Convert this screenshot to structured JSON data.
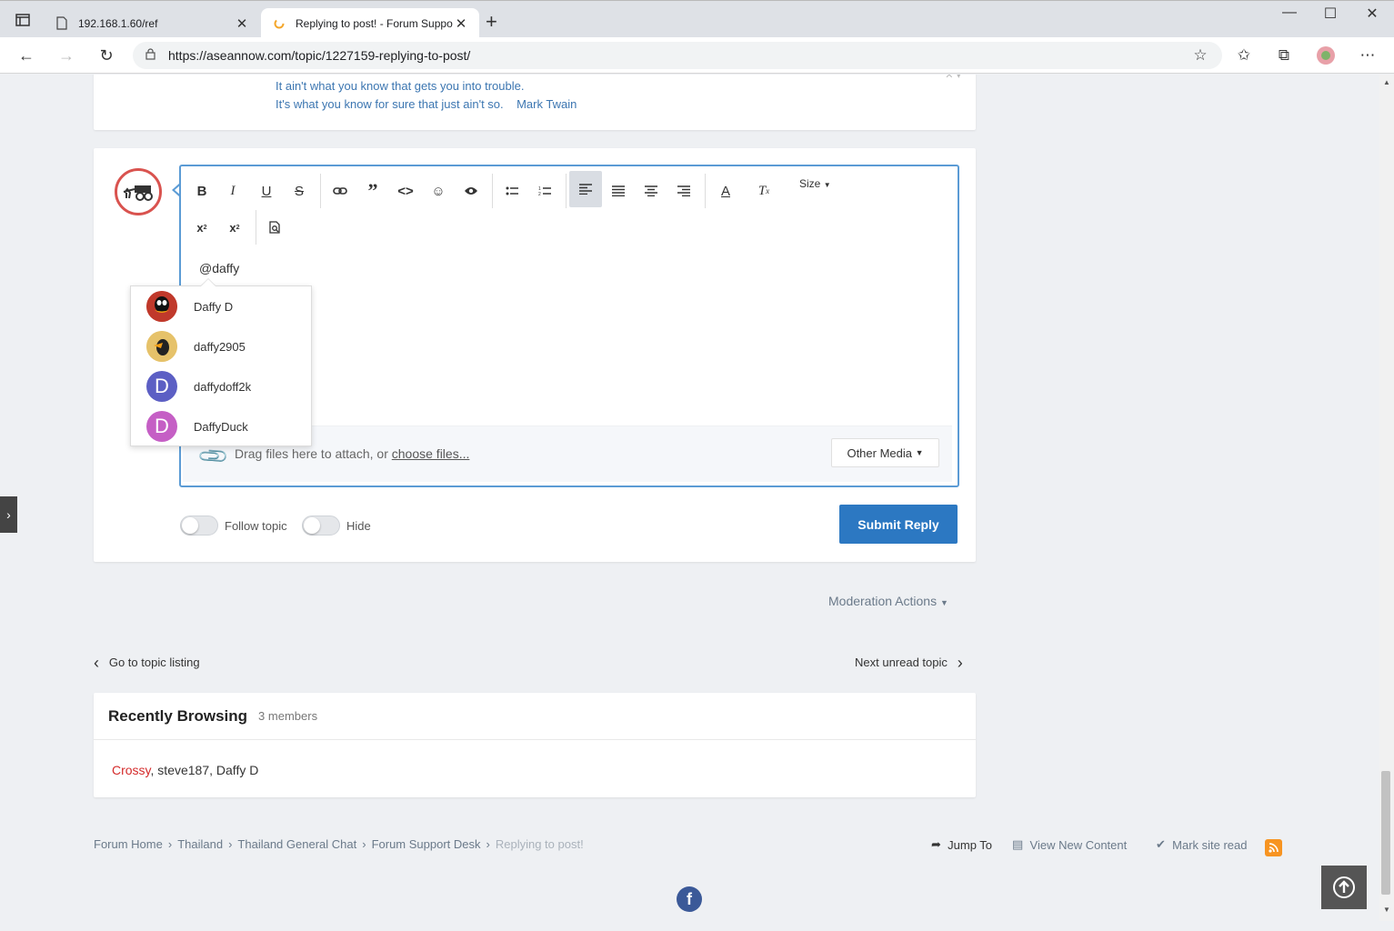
{
  "browser": {
    "tabs": [
      {
        "title": "192.168.1.60/ref",
        "active": false
      },
      {
        "title": "Replying to post! - Forum Suppo",
        "active": true
      }
    ],
    "url": "https://aseannow.com/topic/1227159-replying-to-post/",
    "new_tab_label": "+"
  },
  "signature": {
    "line1": "It ain't what you know that gets you into trouble.",
    "line2": "It's what you know for sure that just ain't so.",
    "author": "Mark Twain"
  },
  "editor": {
    "size_label": "Size",
    "content": "@daffy",
    "attach_text": "Drag files here to attach, or ",
    "attach_link": "choose files...",
    "other_media": "Other Media"
  },
  "mention_results": [
    {
      "name": "Daffy D",
      "avatar": "daffy-cartoon",
      "color": "#c0392b"
    },
    {
      "name": "daffy2905",
      "avatar": "daffy-cartoon-2",
      "color": "#e6c26a"
    },
    {
      "name": "daffydoff2k",
      "avatar": "letter",
      "letter": "D",
      "color": "#5c5fc4"
    },
    {
      "name": "DaffyDuck",
      "avatar": "letter",
      "letter": "D",
      "color": "#c55fc5"
    }
  ],
  "options": {
    "follow_label": "Follow topic",
    "hide_label": "Hide",
    "submit_label": "Submit Reply"
  },
  "moderation": {
    "label": "Moderation Actions"
  },
  "topic_nav": {
    "prev_label": "Go to topic listing",
    "next_label": "Next unread topic"
  },
  "recently_browsing": {
    "title": "Recently Browsing",
    "count": "3 members",
    "member_red": "Crossy",
    "members_rest": ", steve187, Daffy D"
  },
  "breadcrumb": [
    "Forum Home",
    "Thailand",
    "Thailand General Chat",
    "Forum Support Desk",
    "Replying to post!"
  ],
  "footer": {
    "jump_to": "Jump To",
    "view_new": "View New Content",
    "mark_read": "Mark site read"
  },
  "colors": {
    "accent": "#2c78c2",
    "link": "#3c76b1",
    "editor_border": "#5b9bd5",
    "red_user": "#d42b2b"
  }
}
